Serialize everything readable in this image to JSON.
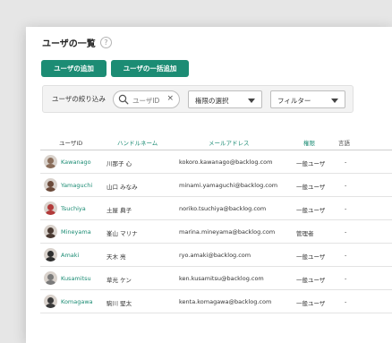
{
  "page": {
    "title": "ユーザの一覧",
    "help_icon": "?"
  },
  "toolbar": {
    "add_user_label": "ユーザの追加",
    "bulk_add_label": "ユーザの一括追加"
  },
  "filter": {
    "label": "ユーザの絞り込み",
    "search_placeholder": "ユーザID",
    "search_clear": "×",
    "permission_select": "権限の選択",
    "filter_select": "フィルター"
  },
  "table": {
    "headers": {
      "user_id": "ユーザID",
      "handle": "ハンドルネーム",
      "email": "メールアドレス",
      "role": "権限",
      "language": "言語"
    },
    "rows": [
      {
        "user_id": "Kawanago",
        "handle": "川那子 心",
        "email": "kokoro.kawanago@backlog.com",
        "role": "一般ユーザ",
        "language": "-",
        "avatar_color": "#8a6d5a"
      },
      {
        "user_id": "Yamaguchi",
        "handle": "山口 みなみ",
        "email": "minami.yamaguchi@backlog.com",
        "role": "一般ユーザ",
        "language": "-",
        "avatar_color": "#6b4a3a"
      },
      {
        "user_id": "Tsuchiya",
        "handle": "土屋 典子",
        "email": "noriko.tsuchiya@backlog.com",
        "role": "一般ユーザ",
        "language": "-",
        "avatar_color": "#b23a3a"
      },
      {
        "user_id": "Mineyama",
        "handle": "峯山 マリナ",
        "email": "marina.mineyama@backlog.com",
        "role": "管理者",
        "language": "-",
        "avatar_color": "#4a3a32"
      },
      {
        "user_id": "Amaki",
        "handle": "天木 亮",
        "email": "ryo.amaki@backlog.com",
        "role": "一般ユーザ",
        "language": "-",
        "avatar_color": "#2e2e2e"
      },
      {
        "user_id": "Kusamitsu",
        "handle": "草光 ケン",
        "email": "ken.kusamitsu@backlog.com",
        "role": "一般ユーザ",
        "language": "-",
        "avatar_color": "#7a7a7a"
      },
      {
        "user_id": "Komagawa",
        "handle": "駒川 堅太",
        "email": "kenta.komagawa@backlog.com",
        "role": "一般ユーザ",
        "language": "-",
        "avatar_color": "#3a3a3a"
      }
    ]
  },
  "colors": {
    "accent": "#1c8c74"
  }
}
